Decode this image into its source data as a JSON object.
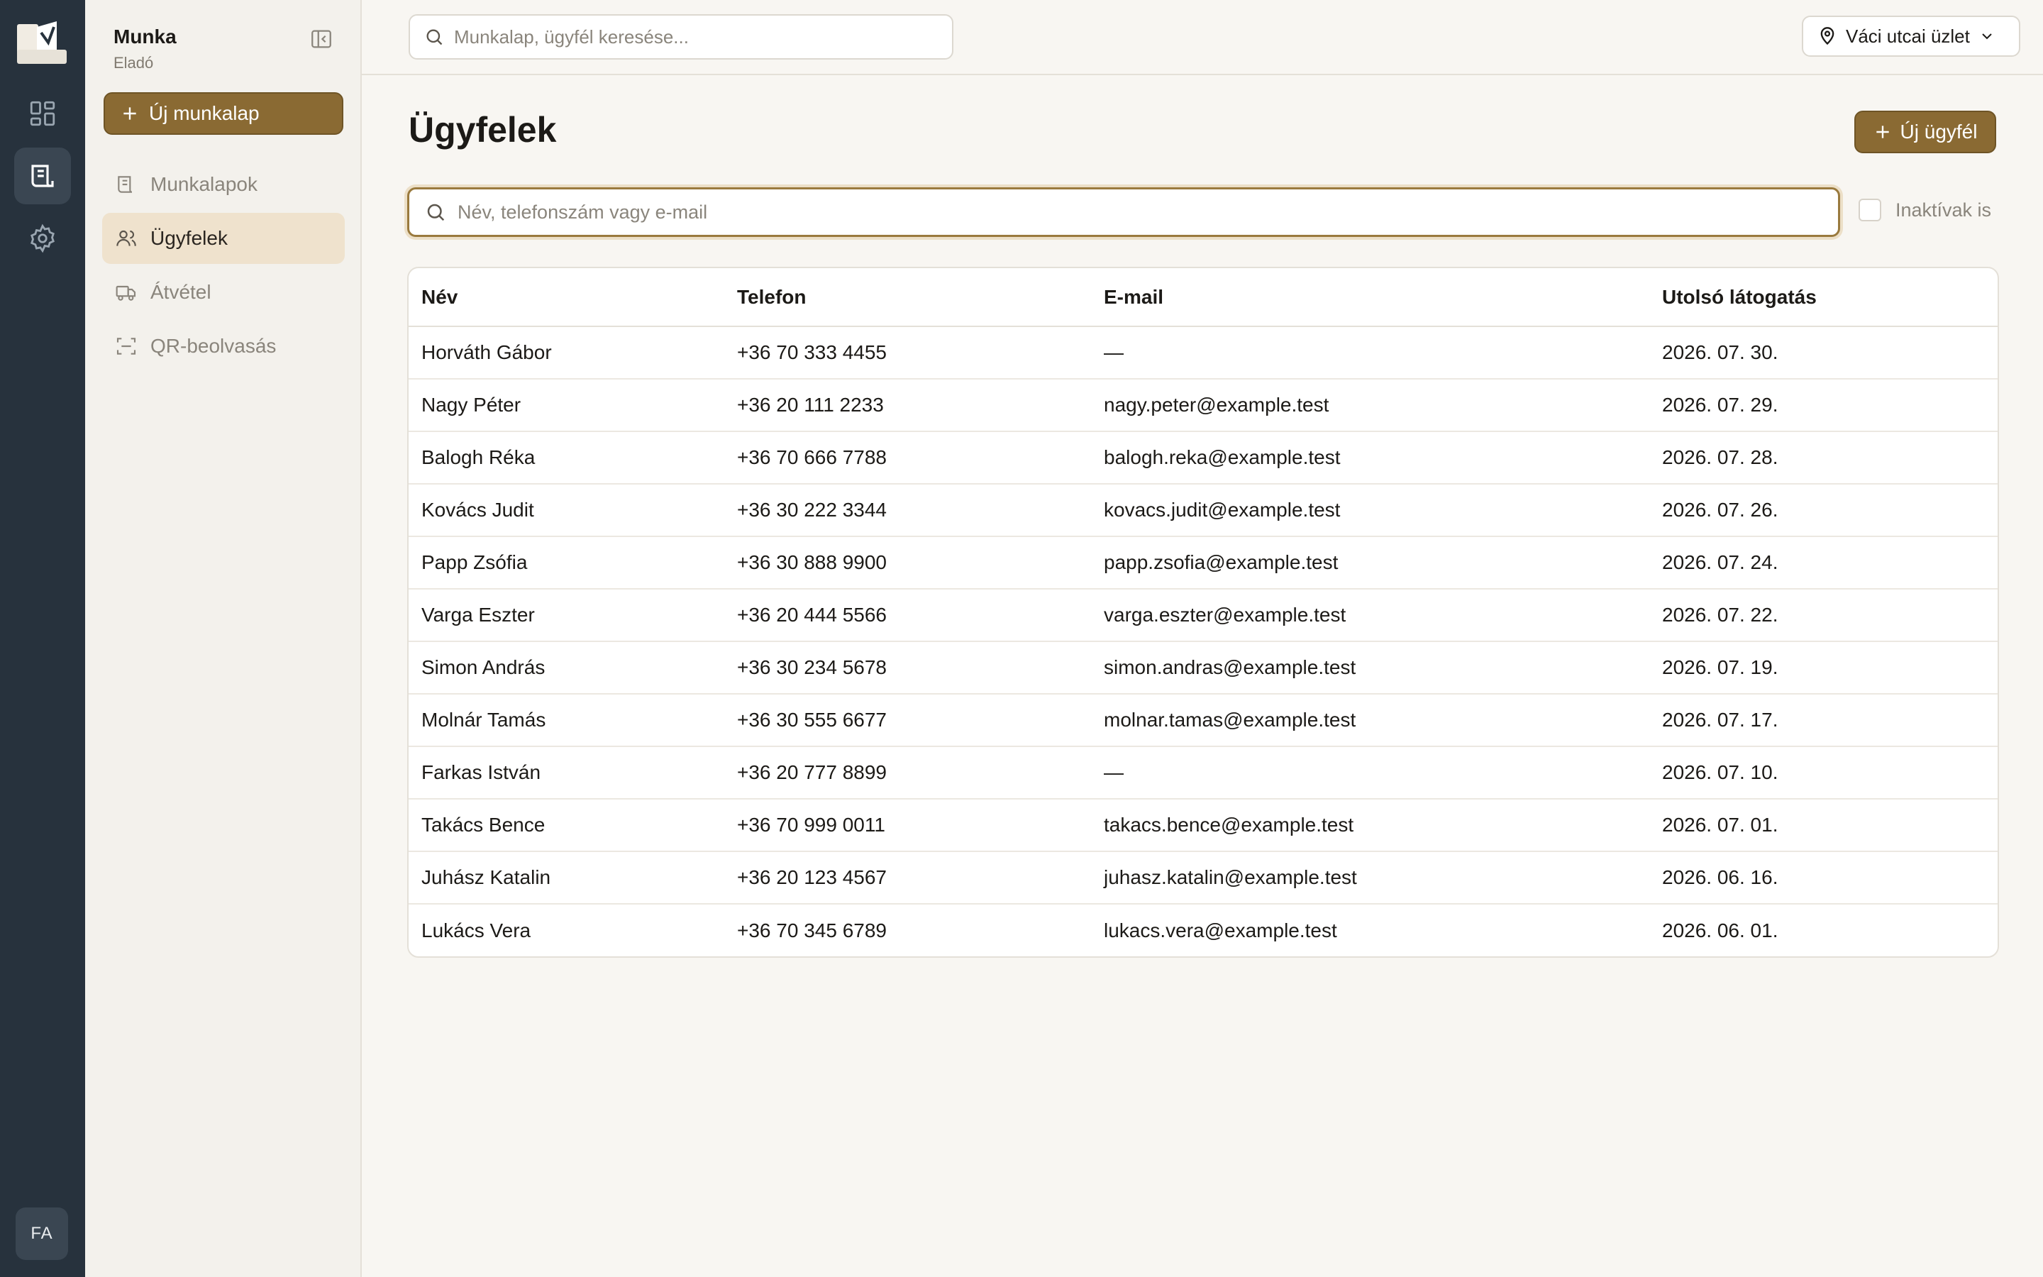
{
  "rail": {
    "avatar_initials": "FA"
  },
  "sidebar": {
    "workspace_title": "Munka",
    "workspace_role": "Eladó",
    "new_button": "Új munkalap",
    "items": [
      {
        "label": "Munkalapok",
        "icon": "worksheet-icon",
        "active": false
      },
      {
        "label": "Ügyfelek",
        "icon": "users-icon",
        "active": true
      },
      {
        "label": "Átvétel",
        "icon": "truck-icon",
        "active": false
      },
      {
        "label": "QR-beolvasás",
        "icon": "scan-icon",
        "active": false
      }
    ]
  },
  "topbar": {
    "search_placeholder": "Munkalap, ügyfél keresése...",
    "store": "Váci utcai üzlet"
  },
  "main": {
    "title": "Ügyfelek",
    "new_client_button": "Új ügyfél",
    "search_placeholder": "Név, telefonszám vagy e-mail",
    "inactive_label": "Inaktívak is"
  },
  "colors": {
    "accent": "#8a6a33",
    "rail": "#27323d",
    "active_nav": "#efe2cd"
  },
  "table": {
    "columns": [
      "Név",
      "Telefon",
      "E-mail",
      "Utolsó látogatás"
    ],
    "rows": [
      [
        "Horváth Gábor",
        "+36 70 333 4455",
        "—",
        "2026. 07. 30."
      ],
      [
        "Nagy Péter",
        "+36 20 111 2233",
        "nagy.peter@example.test",
        "2026. 07. 29."
      ],
      [
        "Balogh Réka",
        "+36 70 666 7788",
        "balogh.reka@example.test",
        "2026. 07. 28."
      ],
      [
        "Kovács Judit",
        "+36 30 222 3344",
        "kovacs.judit@example.test",
        "2026. 07. 26."
      ],
      [
        "Papp Zsófia",
        "+36 30 888 9900",
        "papp.zsofia@example.test",
        "2026. 07. 24."
      ],
      [
        "Varga Eszter",
        "+36 20 444 5566",
        "varga.eszter@example.test",
        "2026. 07. 22."
      ],
      [
        "Simon András",
        "+36 30 234 5678",
        "simon.andras@example.test",
        "2026. 07. 19."
      ],
      [
        "Molnár Tamás",
        "+36 30 555 6677",
        "molnar.tamas@example.test",
        "2026. 07. 17."
      ],
      [
        "Farkas István",
        "+36 20 777 8899",
        "—",
        "2026. 07. 10."
      ],
      [
        "Takács Bence",
        "+36 70 999 0011",
        "takacs.bence@example.test",
        "2026. 07. 01."
      ],
      [
        "Juhász Katalin",
        "+36 20 123 4567",
        "juhasz.katalin@example.test",
        "2026. 06. 16."
      ],
      [
        "Lukács Vera",
        "+36 70 345 6789",
        "lukacs.vera@example.test",
        "2026. 06. 01."
      ]
    ]
  }
}
